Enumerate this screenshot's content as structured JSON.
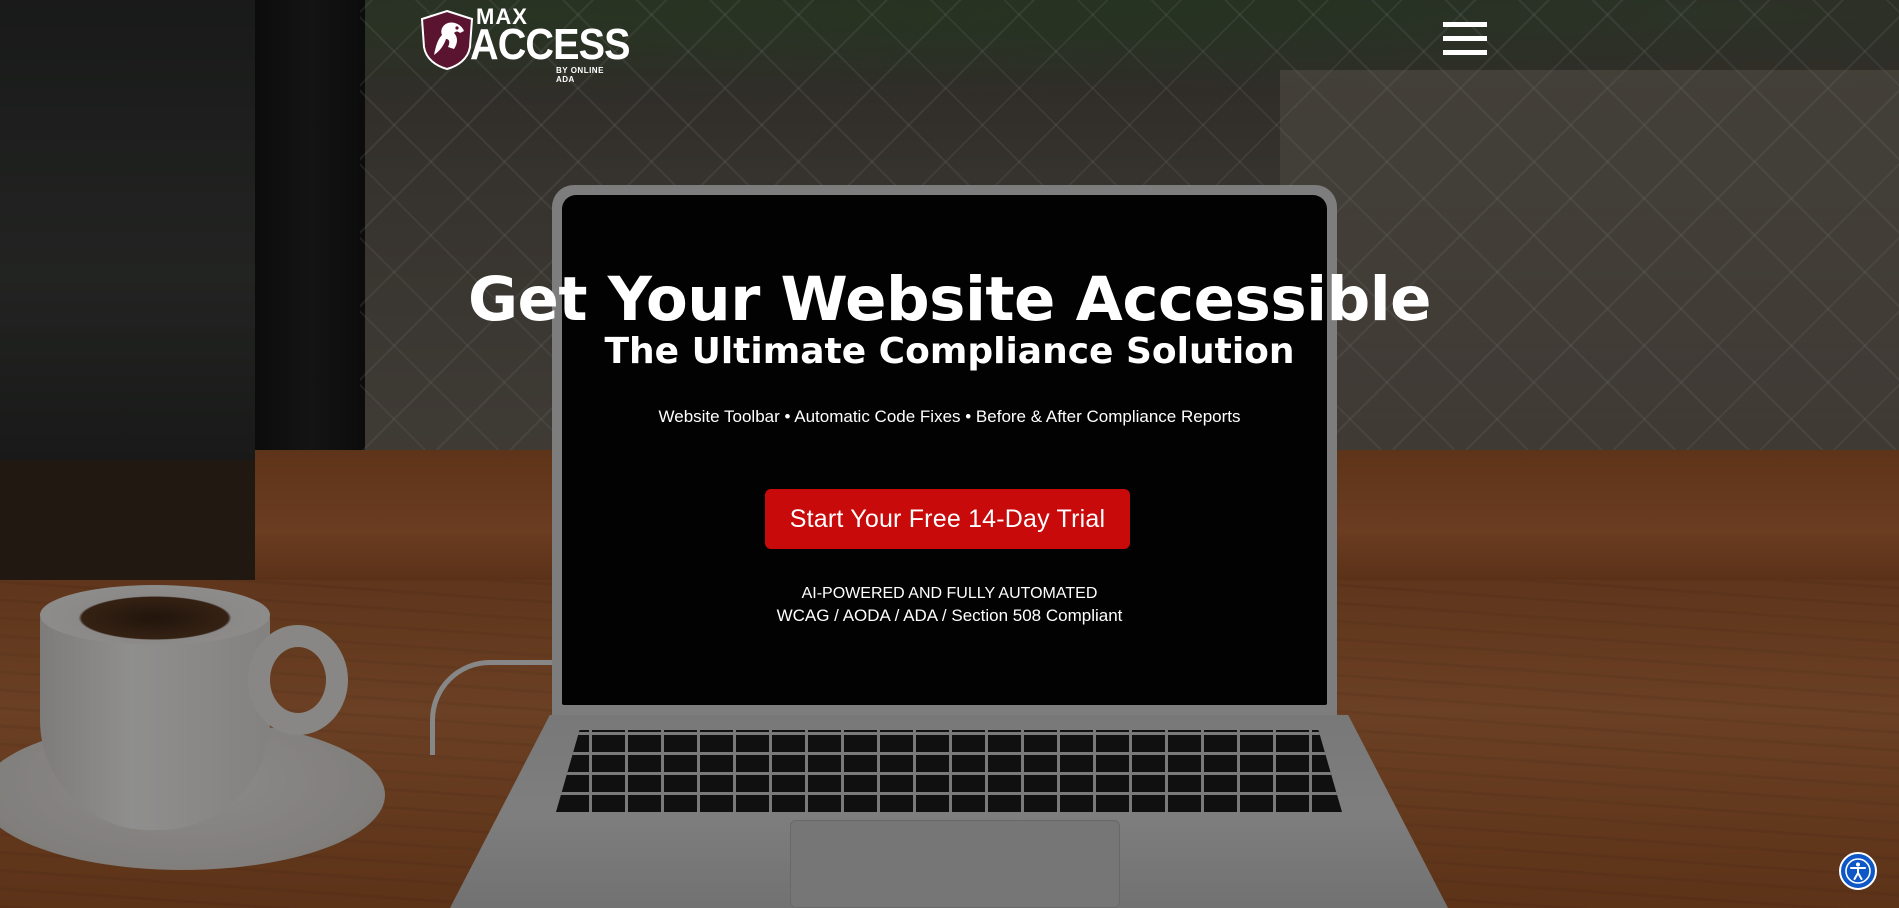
{
  "header": {
    "logo": {
      "line1": "MAX",
      "line2": "ACCESS",
      "byline": "BY ONLINE ADA",
      "icon": "horse-shield-icon"
    },
    "menu_icon": "hamburger-menu-icon"
  },
  "hero": {
    "title": "Get Your Website Accessible",
    "subtitle": "The Ultimate Compliance Solution",
    "features": "Website Toolbar • Automatic Code Fixes • Before & After Compliance Reports",
    "cta_label": "Start Your Free 14-Day Trial",
    "tagline": "AI-POWERED AND FULLY AUTOMATED",
    "compliance": "WCAG / AODA / ADA / Section 508 Compliant"
  },
  "accessibility_widget": {
    "icon": "accessibility-person-icon"
  },
  "colors": {
    "cta": "#c80a0a",
    "a11y_button": "#0d57c6",
    "text": "#ffffff"
  }
}
